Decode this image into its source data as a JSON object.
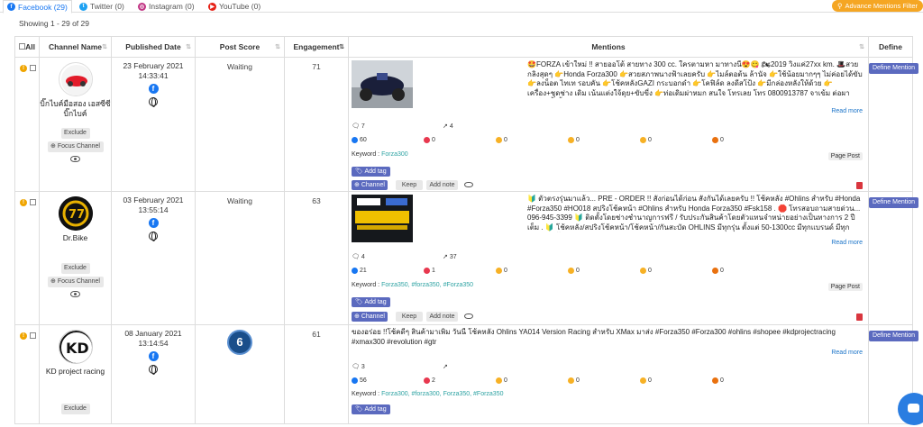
{
  "tabs": [
    {
      "label": "Facebook (29)",
      "icon": "facebook-icon",
      "color": "#1877f2"
    },
    {
      "label": "Twitter (0)",
      "icon": "twitter-icon",
      "color": "#1da1f2"
    },
    {
      "label": "Instagram (0)",
      "icon": "instagram-icon",
      "color": "#c13584"
    },
    {
      "label": "YouTube (0)",
      "icon": "youtube-icon",
      "color": "#e62117"
    }
  ],
  "advanced_filter": "Advance Mentions Filter",
  "showing": "Showing 1 - 29 of 29",
  "columns": {
    "all": "All",
    "channel": "Channel Name",
    "published": "Published Date",
    "score": "Post Score",
    "engagement": "Engagement",
    "mentions": "Mentions",
    "define": "Define"
  },
  "buttons": {
    "exclude": "Exclude",
    "focus": "Focus Channel",
    "add_tag": "Add tag",
    "channel": "Channel",
    "keep": "Keep",
    "add_note": "Add note",
    "define": "Define Mention",
    "read_more": "Read more",
    "page_post": "Page Post",
    "keyword_label": "Keyword :"
  },
  "rows": [
    {
      "channel": "บิ๊กไบค์มือสอง เอสซีซี บิ๊กไบค์",
      "date": "23 February 2021",
      "time": "14:33:41",
      "score": "Waiting",
      "engagement": "71",
      "text": "🤩FORZA เข้าใหม่ !! สายออโต้ สายทาง 300 cc. ใครตามหา มาทางนี้😍😋 🏍2019 วิ่งแค่27xx km. 🎩สวยกลิงสุดๆ 👉Honda Forza300 👉สวยสภาพนางฟ้าเลยครับ 👉ไมล์ตอต้น ล้านัจ 👉ใช้น้อยมากๆๆ ไม่ค่อยได้ขับ 👉ลงน็อต ไทเท รอบคัน 👉โช้คหลังGAZI กระบอกดำ 👉โคฟิล์ด ลงดีสโป้ง 👉มีกล่องหลังให้ด้วย 👉เครื่อง+ชุดช่าง เดิม เน้นแต่งใจ้ดุย+ขับขี่ง 👉ท่อเดิมผ่าหมก สนใจ โทรเลย โทร 0800913787 จาเข้ม ต่อผา ไลน์กดลิ้งนี้...",
      "comments": "7",
      "shares": "4",
      "reactions": [
        "60",
        "0",
        "0",
        "0",
        "0",
        "0"
      ],
      "keyword": "Forza300"
    },
    {
      "channel": "Dr.Bike",
      "date": "03 February 2021",
      "time": "13:55:14",
      "score": "Waiting",
      "engagement": "63",
      "text": "🔰 ตัวตรงรุ่นมาแล้ว... PRE - ORDER !! สั่งก่อนได้ก่อน สั่งกันได้เลยครับ !! โช้คหลัง #Ohlins สำหรับ #Honda #Forza350 #HO018 สปริงโช้คหน้า #Ohlins สำหรับ Honda Forza350 #Fsk158 . 🛑 โทรสอบถามสายด่วน... 096-945-3399 🔰 ติดตั้งโดยช่างชำนาญการฟรี / รับประกันสินค้าโดยตัวแทนจำหน่ายอย่างเป็นทางการ 2 ปีเต็ม . 🔰 โช้คหลัง/สปริงโช้คหน้า/โช้คหน้า/กันสะบัด OHLINS มีทุกรุ่น ตั้งแต่ 50-1300cc มีทุกแบรนด์ มีทุกค่าย มีทุกโฉมปี...",
      "comments": "4",
      "shares": "37",
      "reactions": [
        "21",
        "1",
        "0",
        "0",
        "0",
        "0"
      ],
      "keyword": "Forza350, #forza350, #Forza350"
    },
    {
      "channel": "KD project racing",
      "date": "08 January 2021",
      "time": "13:14:54",
      "score": "6",
      "engagement": "61",
      "text": "ของอร่อย !!โช้คดีๆ สินค้ามาเพิ่ม วันนี้ โช้คหลัง Ohlins YA014 Version Racing สำหรับ XMax มาส่ง #Forza350 #Forza300 #ohlins #shopee #kdprojectracing #xmax300 #revolution #gtr",
      "comments": "3",
      "shares": "",
      "reactions": [
        "56",
        "2",
        "0",
        "0",
        "0",
        "0"
      ],
      "keyword": "Forza300, #forza300, Forza350, #Forza350"
    }
  ]
}
